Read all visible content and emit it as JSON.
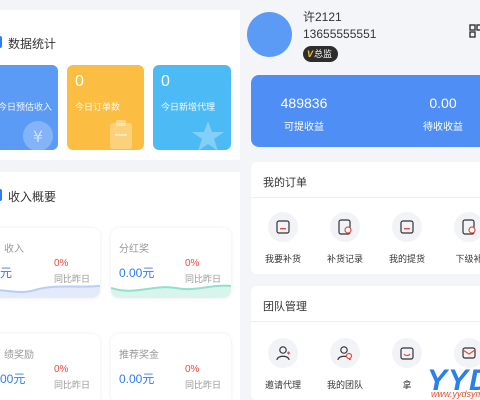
{
  "data_stats": {
    "title": "数据统计",
    "cards": [
      {
        "value": "",
        "label": "今日预估收入",
        "color": "#5b9af5"
      },
      {
        "value": "0",
        "label": "今日订单数",
        "color": "#fbbe42"
      },
      {
        "value": "0",
        "label": "今日新增代理",
        "color": "#4cbbf5"
      }
    ]
  },
  "income_overview": {
    "title": "收入概要",
    "items": [
      {
        "title": "收入",
        "value": "元",
        "pct": "0%",
        "compare": "同比昨日",
        "wave_color": "#b9cdf7"
      },
      {
        "title": "分红奖",
        "value": "0.00元",
        "pct": "0%",
        "compare": "同比昨日",
        "wave_color": "#8fe0cd"
      },
      {
        "title": "绩奖励",
        "value": "00元",
        "pct": "0%",
        "compare": "同比昨日",
        "wave_color": "#d8b9f2"
      },
      {
        "title": "推荐奖金",
        "value": "0.00元",
        "pct": "0%",
        "compare": "同比昨日",
        "wave_color": "#d8b9f2"
      }
    ]
  },
  "profile": {
    "name": "许2121",
    "phone": "13655555551",
    "badge_icon": "V",
    "badge_label": "总监"
  },
  "balance": {
    "withdrawable_value": "489836",
    "withdrawable_label": "可提收益",
    "pending_value": "0.00",
    "pending_label": "待收收益"
  },
  "my_orders": {
    "title": "我的订单",
    "items": [
      {
        "label": "我要补货",
        "icon": "restock-icon"
      },
      {
        "label": "补货记录",
        "icon": "restock-record-icon"
      },
      {
        "label": "我的提货",
        "icon": "pickup-icon"
      },
      {
        "label": "下级补",
        "icon": "sub-restock-icon"
      }
    ]
  },
  "team": {
    "title": "团队管理",
    "items": [
      {
        "label": "邀请代理",
        "icon": "invite-icon"
      },
      {
        "label": "我的团队",
        "icon": "team-icon"
      },
      {
        "label": "拿",
        "icon": "wallet-icon"
      },
      {
        "label": "",
        "icon": "message-icon"
      }
    ]
  },
  "watermark": {
    "brand": "YYDSY",
    "url": "www.yydsym.c"
  },
  "colors": {
    "accent": "#2e7cf6",
    "balance_bg": "#4f8ef5",
    "negative": "#f0483e"
  }
}
